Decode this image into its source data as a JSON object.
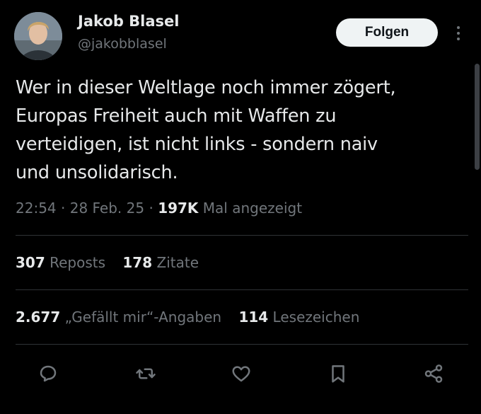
{
  "author": {
    "name": "Jakob Blasel",
    "handle": "@jakobblasel"
  },
  "follow_button": {
    "label": "Folgen"
  },
  "more_icon": "more-vertical-icon",
  "tweet": {
    "lines": [
      "Wer in dieser Weltlage noch immer zögert,",
      "Europas Freiheit auch mit Waffen zu",
      "verteidigen, ist nicht links - sondern naiv",
      "und unsolidarisch."
    ]
  },
  "meta": {
    "time": "22:54",
    "date": "28 Feb. 25",
    "separator": "·",
    "views": "197K",
    "views_label": "Mal angezeigt"
  },
  "stats": {
    "reposts_count": "307",
    "reposts_label": "Reposts",
    "quotes_count": "178",
    "quotes_label": "Zitate",
    "likes_count": "2.677",
    "likes_label": "„Gefällt mir“-Angaben",
    "bookmarks_count": "114",
    "bookmarks_label": "Lesezeichen"
  },
  "actions": [
    "reply-icon",
    "repost-icon",
    "like-icon",
    "bookmark-icon",
    "share-icon"
  ],
  "colors": {
    "background": "#000000",
    "primary_text": "#e7e9ea",
    "secondary_text": "#71767b",
    "divider": "#2f3336",
    "button_bg": "#eff3f4"
  }
}
